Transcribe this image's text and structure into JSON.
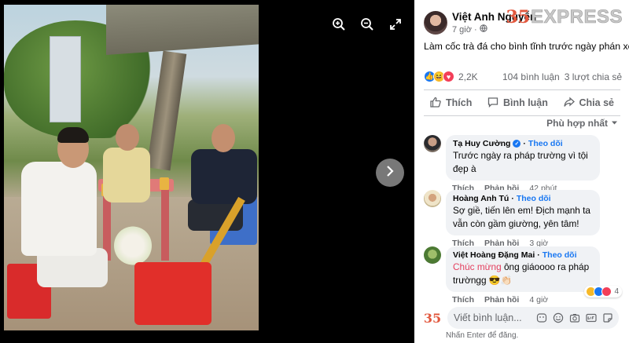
{
  "viewer": {
    "controls": {
      "zoom_in_icon": "zoom-in-icon",
      "zoom_out_icon": "zoom-out-icon",
      "fullscreen_icon": "fullscreen-icon",
      "next_icon": "chevron-right-icon"
    }
  },
  "post": {
    "author": "Việt Anh Nguyễn",
    "time": "7 giờ",
    "privacy_icon": "globe-icon",
    "caption": "Làm cốc trà đá cho bình tĩnh trước ngày phán xét",
    "logo_mark": "35",
    "logo_word": "EXPRESS",
    "reactions_count": "2,2K",
    "comments_count": "104 bình luận",
    "shares_count": "3 lượt chia sẻ",
    "actions": {
      "like": "Thích",
      "comment": "Bình luận",
      "share": "Chia sẻ"
    },
    "sort_label": "Phù hợp nhất"
  },
  "comments": [
    {
      "name": "Tạ Huy Cường",
      "verified": true,
      "follow": "Theo dõi",
      "text": "Trước ngày ra pháp trường vì tội đẹp à",
      "like": "Thích",
      "reply": "Phản hồi",
      "time": "42 phút"
    },
    {
      "name": "Hoàng Anh Tú",
      "verified": false,
      "follow": "Theo dõi",
      "text": "Sợ giề, tiến lên em! Địch mạnh ta vẫn còn gầm giường, yên tâm!",
      "like": "Thích",
      "reply": "Phản hồi",
      "time": "3 giờ"
    },
    {
      "name": "Việt Hoàng Đặng Mai",
      "verified": false,
      "follow": "Theo dõi",
      "text_highlight": "Chúc mừng",
      "text_rest": " ông giáoooo ra pháp trườngg 😎👏🏻",
      "like": "Thích",
      "reply": "Phản hồi",
      "time": "4 giờ",
      "reaction_count": "4"
    }
  ],
  "composer": {
    "avatar_mark": "35",
    "placeholder": "Viết bình luận...",
    "hint": "Nhấn Enter để đăng."
  },
  "colors": {
    "facebook_blue": "#1877f2",
    "brand_red": "#e2583e",
    "highlight_pink": "#e4405f"
  }
}
